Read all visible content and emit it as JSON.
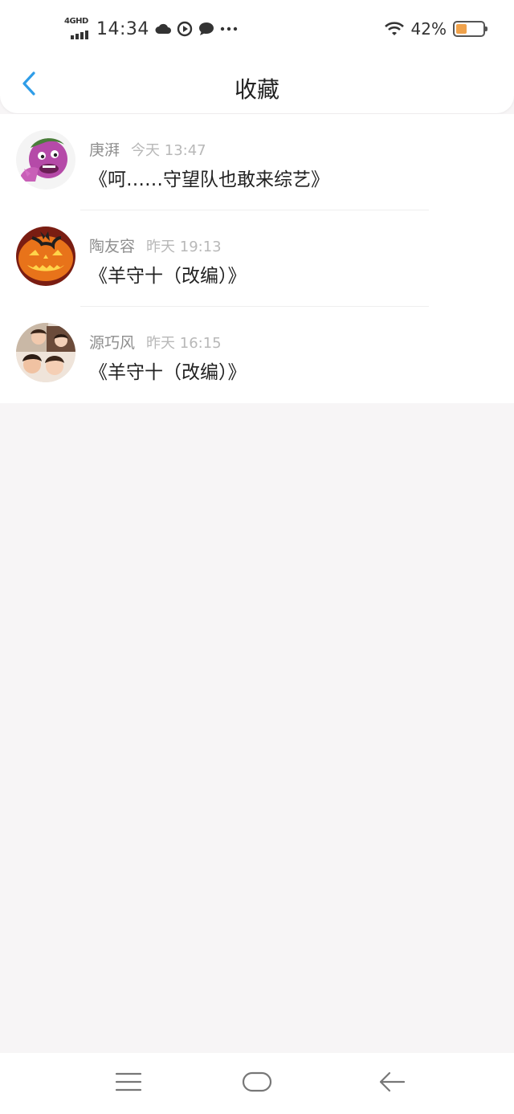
{
  "status_bar": {
    "network": "4GHD",
    "time": "14:34",
    "battery_percent": "42%",
    "battery_level": 0.42,
    "icons": [
      "signal-icon",
      "weather-cloud-icon",
      "media-play-icon",
      "chat-bubble-icon",
      "more-dots-icon",
      "wifi-icon",
      "battery-icon"
    ]
  },
  "header": {
    "title": "收藏",
    "back_icon": "chevron-left-icon",
    "accent_color": "#2f9de8"
  },
  "favorites": [
    {
      "name": "庚湃",
      "time": "今天 13:47",
      "post": "《呵……守望队也敢来综艺》",
      "avatar": "cartoon-avatar"
    },
    {
      "name": "陶友容",
      "time": "昨天 19:13",
      "post": "《羊守十（改编）》",
      "avatar": "pumpkin-avatar"
    },
    {
      "name": "源巧风",
      "time": "昨天 16:15",
      "post": "《羊守十（改编）》",
      "avatar": "photo-collage-avatar"
    }
  ],
  "system_nav": {
    "icons": [
      "menu-icon",
      "home-icon",
      "back-arrow-icon"
    ]
  }
}
